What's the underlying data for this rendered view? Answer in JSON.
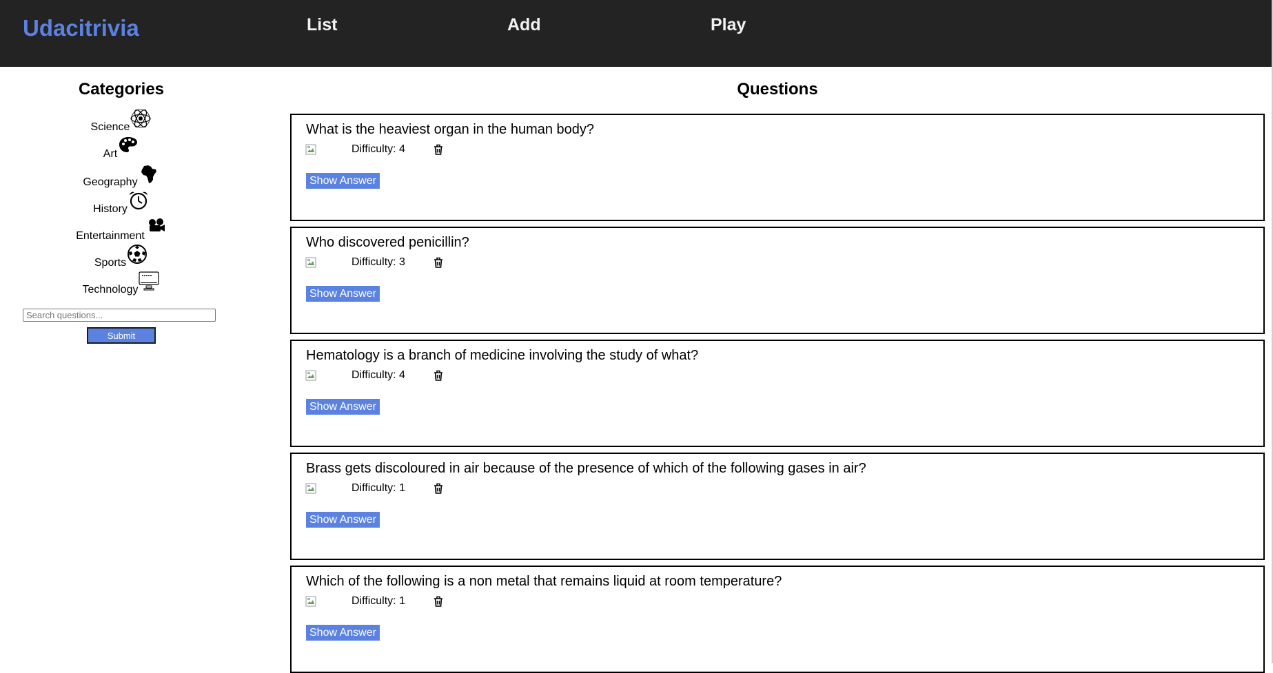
{
  "brand": {
    "name": "Udacitrivia",
    "color": "#5b82e0"
  },
  "nav": [
    {
      "label": "List"
    },
    {
      "label": "Add"
    },
    {
      "label": "Play"
    }
  ],
  "sidebar": {
    "title": "Categories",
    "categories": [
      {
        "label": "Science",
        "icon": "atom-icon"
      },
      {
        "label": "Art",
        "icon": "palette-icon"
      },
      {
        "label": "Geography",
        "icon": "africa-map-icon"
      },
      {
        "label": "History",
        "icon": "alarm-clock-icon"
      },
      {
        "label": "Entertainment",
        "icon": "film-camera-icon"
      },
      {
        "label": "Sports",
        "icon": "soccer-ball-icon"
      },
      {
        "label": "Technology",
        "icon": "computer-monitor-icon"
      }
    ],
    "search": {
      "placeholder": "Search questions...",
      "value": ""
    },
    "submit_label": "Submit"
  },
  "main": {
    "title": "Questions",
    "questions": [
      {
        "question": "What is the heaviest organ in the human body?",
        "difficulty": "Difficulty: 4",
        "show_answer": "Show Answer"
      },
      {
        "question": "Who discovered penicillin?",
        "difficulty": "Difficulty: 3",
        "show_answer": "Show Answer"
      },
      {
        "question": "Hematology is a branch of medicine involving the study of what?",
        "difficulty": "Difficulty: 4",
        "show_answer": "Show Answer"
      },
      {
        "question": "Brass gets discoloured in air because of the presence of which of the following gases in air?",
        "difficulty": "Difficulty: 1",
        "show_answer": "Show Answer"
      },
      {
        "question": "Which of the following is a non metal that remains liquid at room temperature?",
        "difficulty": "Difficulty: 1",
        "show_answer": "Show Answer"
      }
    ]
  }
}
